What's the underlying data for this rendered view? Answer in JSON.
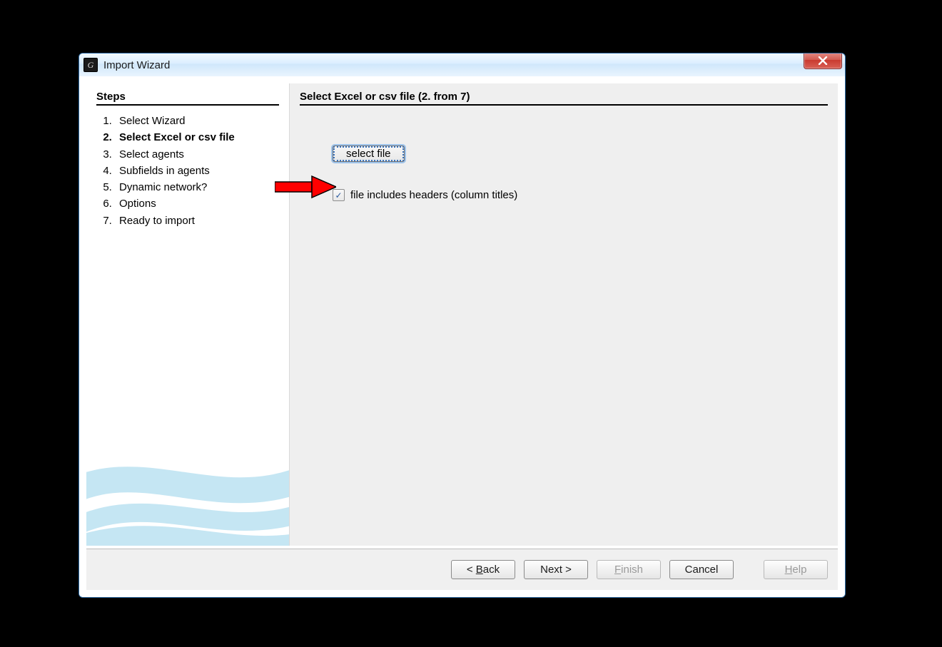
{
  "window": {
    "title": "Import Wizard",
    "close_glyph": "✕"
  },
  "sidebar": {
    "heading": "Steps",
    "current_index": 1,
    "items": [
      "Select Wizard",
      "Select Excel or csv file",
      "Select agents",
      "Subfields in agents",
      "Dynamic network?",
      "Options",
      "Ready to import"
    ]
  },
  "content": {
    "heading": "Select Excel or csv file (2. from 7)",
    "select_file_label": "select file",
    "headers_checkbox_label": "file includes headers (column titles)",
    "headers_checkbox_checked": true
  },
  "buttons": {
    "back": "< Back",
    "next": "Next >",
    "finish": "Finish",
    "cancel": "Cancel",
    "help": "Help",
    "finish_enabled": false,
    "help_enabled": false
  },
  "annotation": {
    "description": "red arrow pointing at headers checkbox"
  }
}
